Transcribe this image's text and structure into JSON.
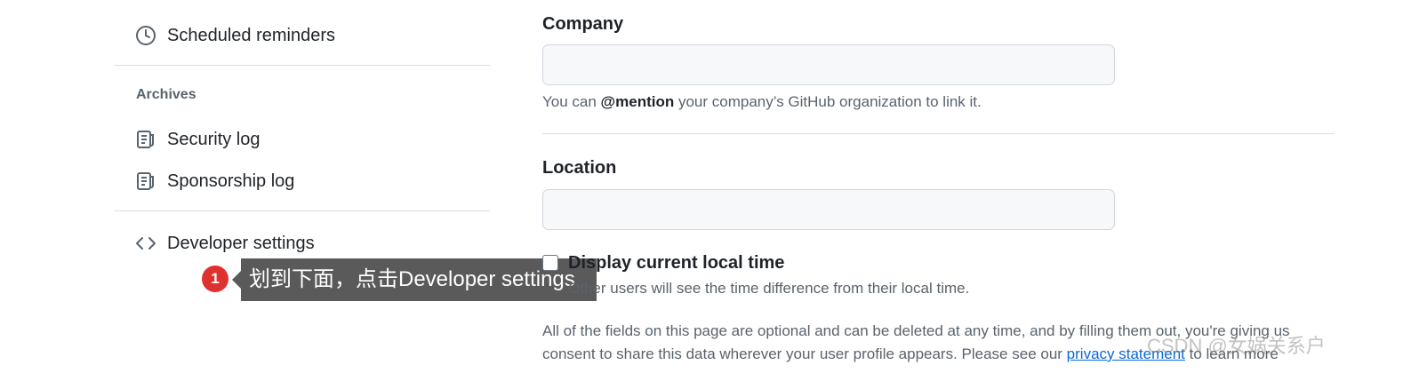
{
  "sidebar": {
    "items": [
      {
        "label": "Scheduled reminders",
        "icon": "clock-icon"
      },
      {
        "label": "Security log",
        "icon": "log-icon"
      },
      {
        "label": "Sponsorship log",
        "icon": "log-icon"
      },
      {
        "label": "Developer settings",
        "icon": "code-icon"
      }
    ],
    "archives_title": "Archives"
  },
  "form": {
    "company": {
      "label": "Company",
      "value": "",
      "help_prefix": "You can ",
      "help_bold": "@mention",
      "help_suffix": " your company’s GitHub organization to link it."
    },
    "location": {
      "label": "Location",
      "value": ""
    },
    "local_time": {
      "label": "Display current local time",
      "checked": false,
      "help": "Other users will see the time difference from their local time."
    },
    "footer": {
      "line1": "All of the fields on this page are optional and can be deleted at any time, and by filling them out, you're giving us",
      "line2_prefix": "consent to share this data wherever your user profile appears. Please see our ",
      "line2_link": "privacy statement",
      "line2_suffix": " to learn more"
    }
  },
  "annotation": {
    "step": "1",
    "text": "划到下面，点击Developer settings",
    "badge_color": "#e03131"
  },
  "watermark": "CSDN @女娲关系户"
}
